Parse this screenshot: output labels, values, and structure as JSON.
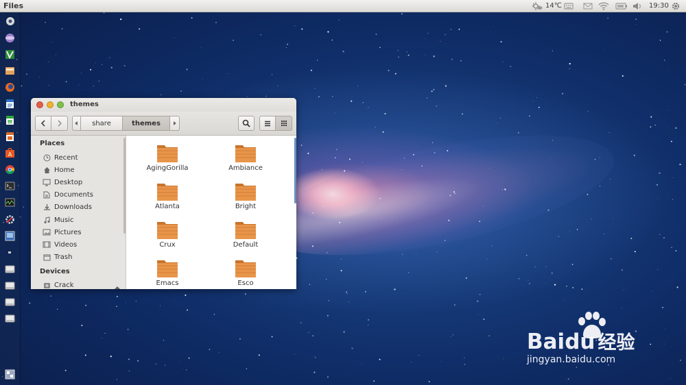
{
  "top_panel": {
    "app_title": "Files",
    "temperature": "14℃",
    "clock": "19:30",
    "tray_icons": [
      "weather-icon",
      "keyboard-icon",
      "mail-icon",
      "wifi-icon",
      "battery-icon",
      "volume-icon",
      "gear-icon"
    ]
  },
  "launcher": {
    "items": [
      "dash-home-icon",
      "browser-icon",
      "vim-icon",
      "files-icon",
      "firefox-icon",
      "writer-icon",
      "calc-icon",
      "impress-icon",
      "software-center-icon",
      "chrome-icon",
      "terminal-icon",
      "system-monitor-icon",
      "settings-icon",
      "screenshot-icon",
      "small-app-icon",
      "drive-icon",
      "drive-icon",
      "drive-icon",
      "drive-icon",
      "workspace-switcher-icon"
    ]
  },
  "window": {
    "title": "themes",
    "breadcrumbs": [
      {
        "label": "share"
      },
      {
        "label": "themes"
      }
    ],
    "sidebar": {
      "places_heading": "Places",
      "places": [
        {
          "label": "Recent",
          "icon": "clock-icon"
        },
        {
          "label": "Home",
          "icon": "home-icon"
        },
        {
          "label": "Desktop",
          "icon": "desktop-icon"
        },
        {
          "label": "Documents",
          "icon": "document-icon"
        },
        {
          "label": "Downloads",
          "icon": "download-icon"
        },
        {
          "label": "Music",
          "icon": "music-icon"
        },
        {
          "label": "Pictures",
          "icon": "picture-icon"
        },
        {
          "label": "Videos",
          "icon": "video-icon"
        },
        {
          "label": "Trash",
          "icon": "trash-icon"
        }
      ],
      "devices_heading": "Devices",
      "devices": [
        {
          "label": "Crack",
          "icon": "drive-icon"
        }
      ]
    },
    "folders": [
      {
        "name": "AgingGorilla"
      },
      {
        "name": "Ambiance"
      },
      {
        "name": "Atlanta"
      },
      {
        "name": "Bright"
      },
      {
        "name": "Crux"
      },
      {
        "name": "Default"
      },
      {
        "name": "Emacs"
      },
      {
        "name": "Esco"
      }
    ]
  },
  "watermark": {
    "brand": "Bai",
    "brand2": "du",
    "cn": "经验",
    "url": "jingyan.baidu.com"
  },
  "colors": {
    "folder": "#e8954a",
    "accent": "#6a8fc0"
  }
}
